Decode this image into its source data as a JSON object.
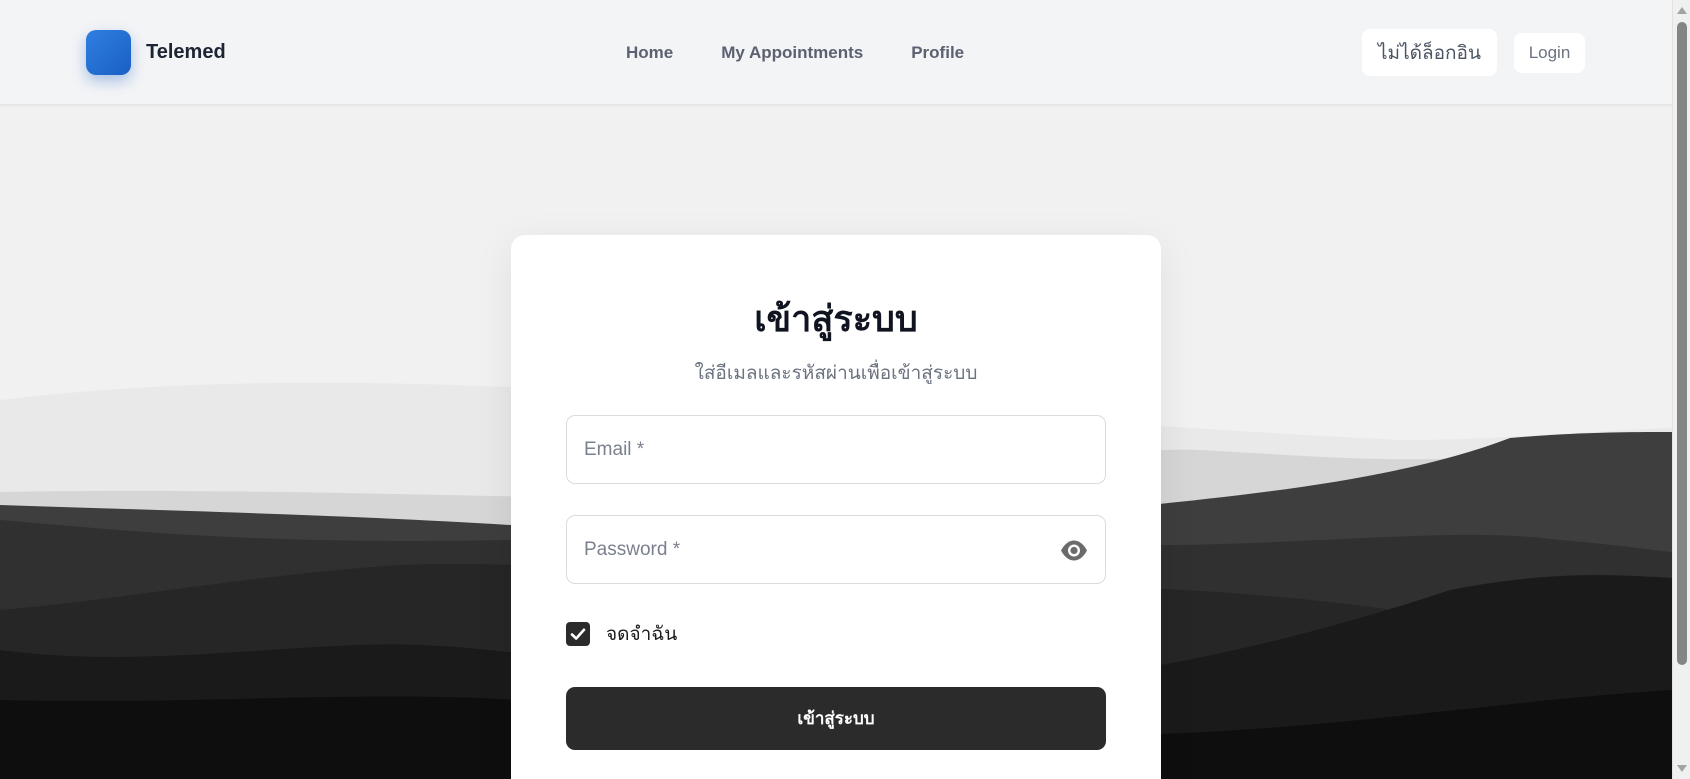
{
  "app": {
    "name": "Telemed"
  },
  "nav": {
    "items": [
      {
        "label": "Home"
      },
      {
        "label": "My Appointments"
      },
      {
        "label": "Profile"
      }
    ]
  },
  "header": {
    "status": "ไม่ได้ล็อกอิน",
    "login_label": "Login"
  },
  "login_card": {
    "title": "เข้าสู่ระบบ",
    "subtitle": "ใส่อีเมลและรหัสผ่านเพื่อเข้าสู่ระบบ",
    "email": {
      "value": "",
      "placeholder": "Email *"
    },
    "password": {
      "value": "",
      "placeholder": "Password *"
    },
    "remember": {
      "label": "จดจำฉัน",
      "checked": true
    },
    "submit_label": "เข้าสู่ระบบ"
  },
  "colors": {
    "brand": "#2f7fe0",
    "button_dark": "#2b2b2b",
    "header_bg": "#f3f4f6"
  },
  "icons": {
    "logo": "square-logo-icon",
    "password_toggle": "eye-icon",
    "checkbox": "checkmark-icon"
  }
}
